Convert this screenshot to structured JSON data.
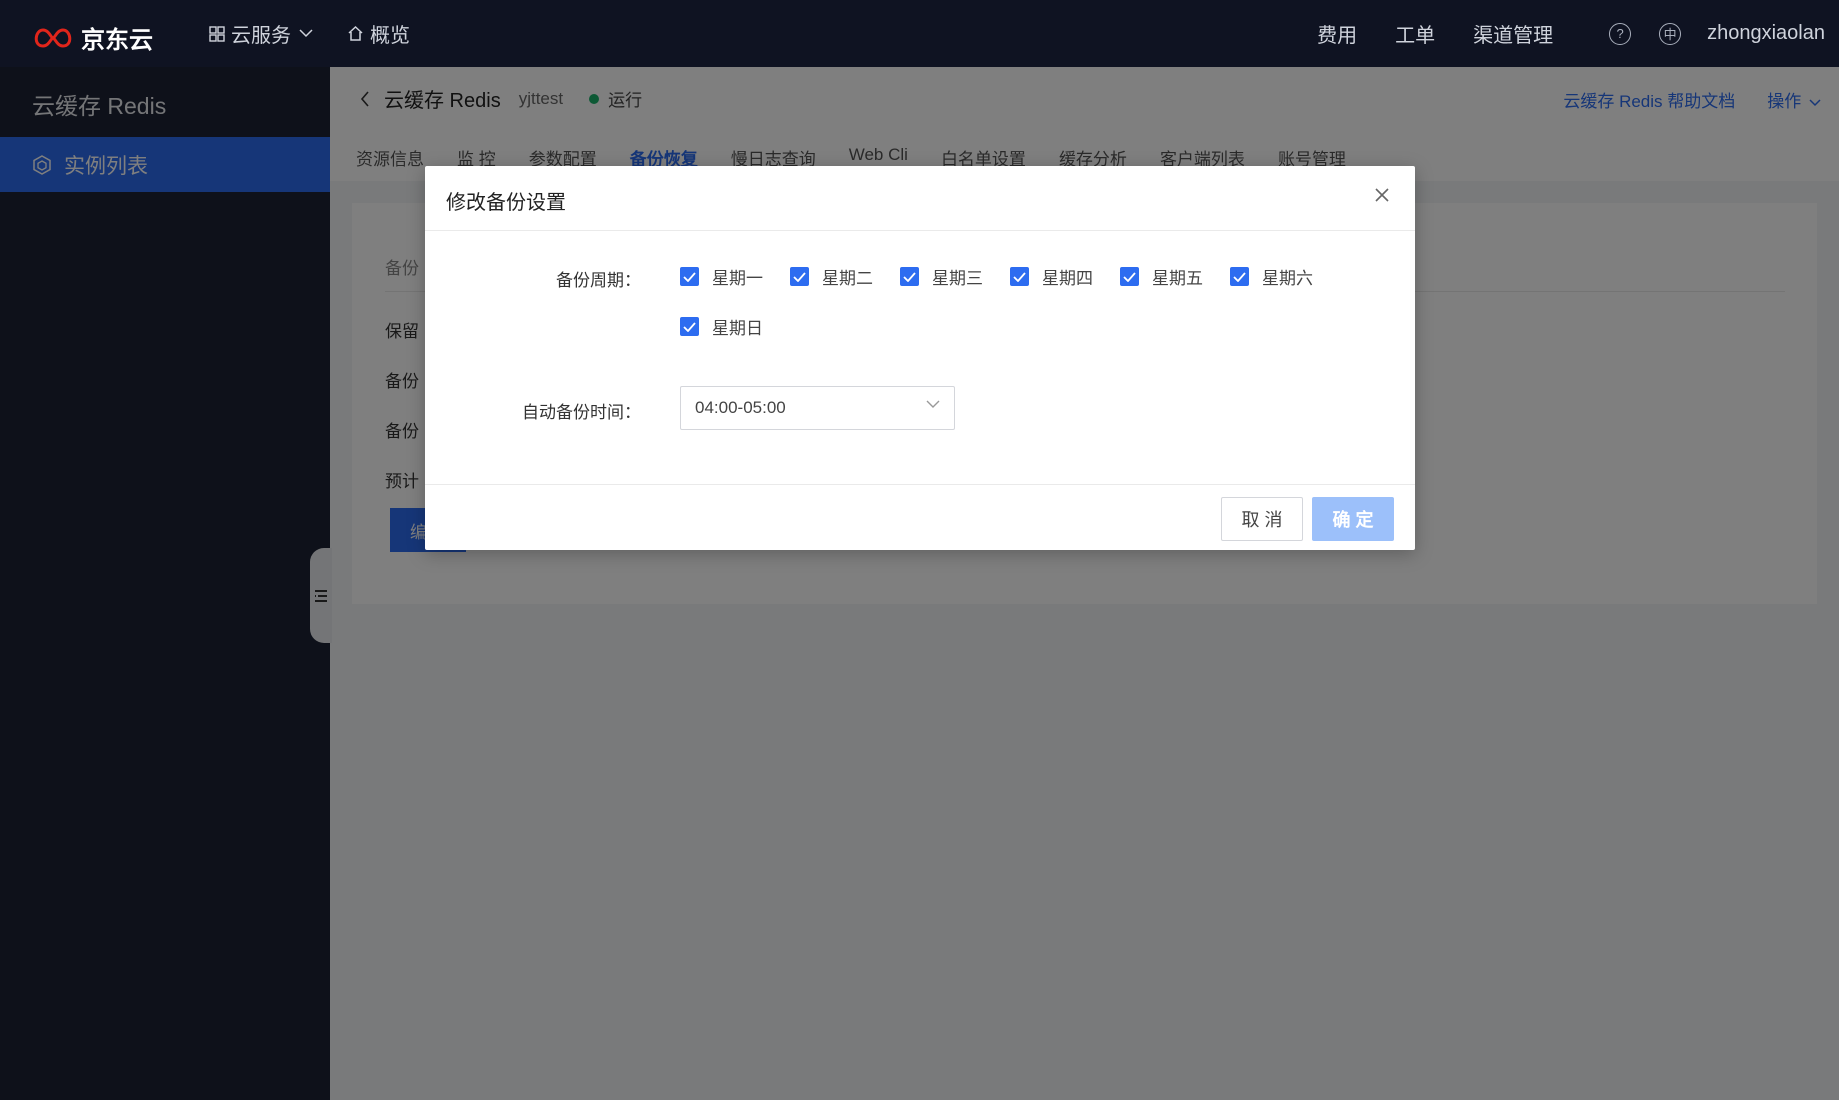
{
  "topbar": {
    "brand": "京东云",
    "cloud_services": "云服务",
    "overview": "概览",
    "fees": "费用",
    "tickets": "工单",
    "channel_mgmt": "渠道管理",
    "username": "zhongxiaolan"
  },
  "sidebar": {
    "title": "云缓存 Redis",
    "items": [
      {
        "label": "实例列表"
      }
    ]
  },
  "header": {
    "product": "云缓存 Redis",
    "instance": "yjttest",
    "status": "运行",
    "help_link": "云缓存 Redis 帮助文档",
    "actions": "操作"
  },
  "tabs": [
    "资源信息",
    "监 控",
    "参数配置",
    "备份恢复",
    "慢日志查询",
    "Web Cli",
    "白名单设置",
    "缓存分析",
    "客户端列表",
    "账号管理"
  ],
  "card": {
    "head": "备份",
    "rows": [
      "保留",
      "备份",
      "备份",
      "预计"
    ],
    "button": "编"
  },
  "modal": {
    "title": "修改备份设置",
    "cycle_label": "备份周期：",
    "days": [
      "星期一",
      "星期二",
      "星期三",
      "星期四",
      "星期五",
      "星期六",
      "星期日"
    ],
    "time_label": "自动备份时间：",
    "time_value": "04:00-05:00",
    "cancel": "取 消",
    "confirm": "确 定"
  },
  "colors": {
    "primary": "#2d6cf0",
    "topbar_bg": "#0f1322",
    "sidebar_bg": "#1d2335",
    "status_green": "#1ab26b",
    "disabled_btn": "#9cc0fa"
  }
}
